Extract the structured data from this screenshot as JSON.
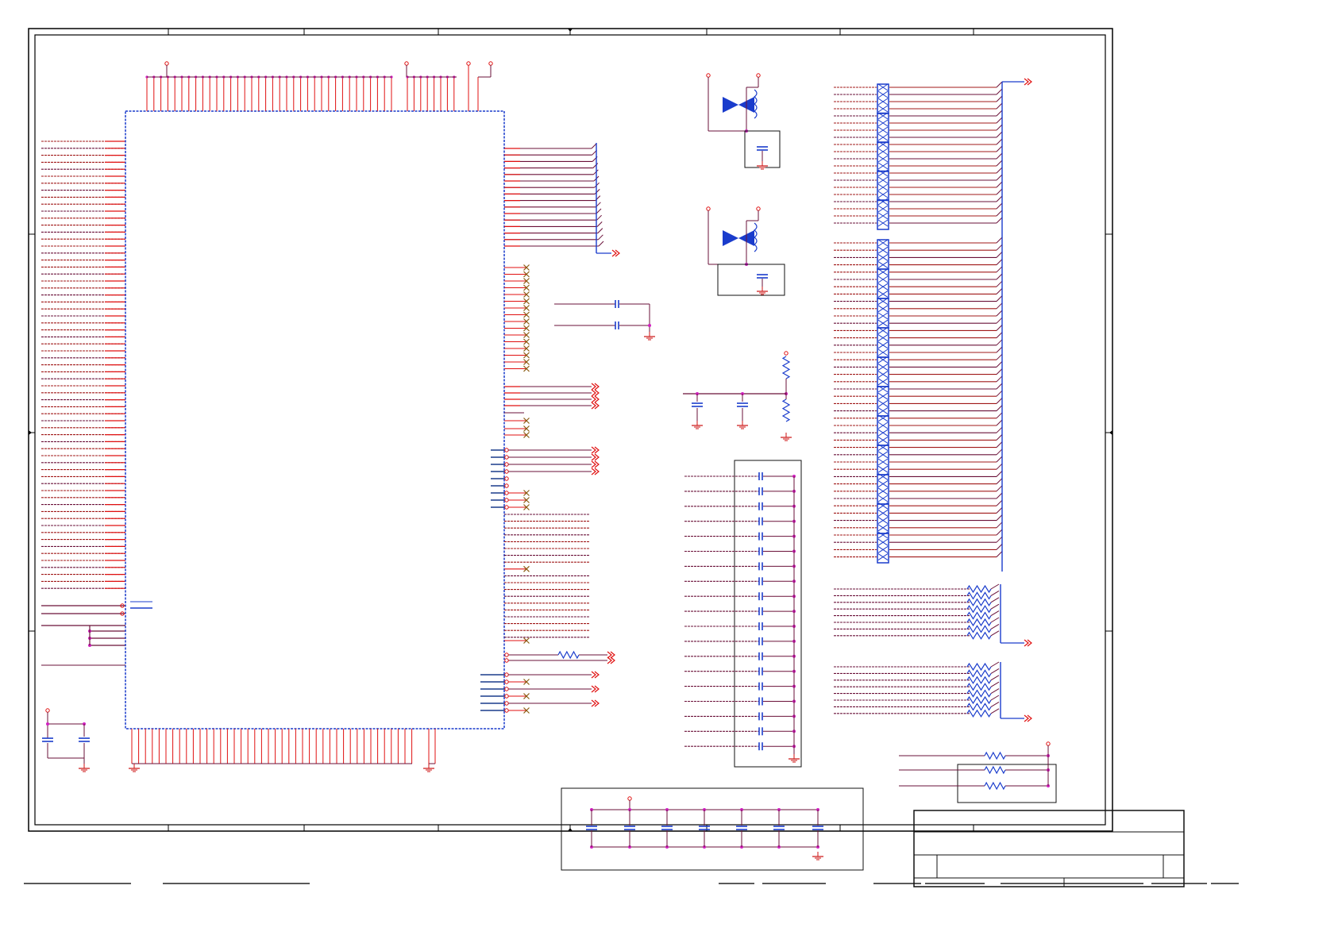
{
  "document": {
    "type": "schematic",
    "grid_zones": 8,
    "title_block_text": []
  },
  "colors": {
    "background": "#ffffff",
    "frame": "#000000",
    "signal_wire": "#a01818",
    "bus_wire": "#6a1038",
    "chip_outline": "#1a3ccc",
    "pin_stub": "#e01010",
    "junction": "#d020c0",
    "no_connect": "#8a5a10",
    "passive": "#1a3ccc",
    "ground": "#cc1010"
  },
  "components": {
    "main_ic": {
      "type": "ic-package",
      "left_pins": 78,
      "right_pins": 78,
      "top_pins": 44,
      "bottom_pins": 44
    },
    "crystal_circuits": 2,
    "resistor_networks": 20,
    "decoupling_caps": 19,
    "bulk_caps": 7
  },
  "icons": {
    "ground": "ground-symbol-icon",
    "power": "power-port-icon",
    "off_page": "off-page-connector-icon",
    "no_connect": "no-connect-x-icon",
    "resistor": "resistor-zigzag-icon",
    "capacitor": "capacitor-icon",
    "diode": "diode-icon",
    "inductor": "inductor-coil-icon"
  }
}
